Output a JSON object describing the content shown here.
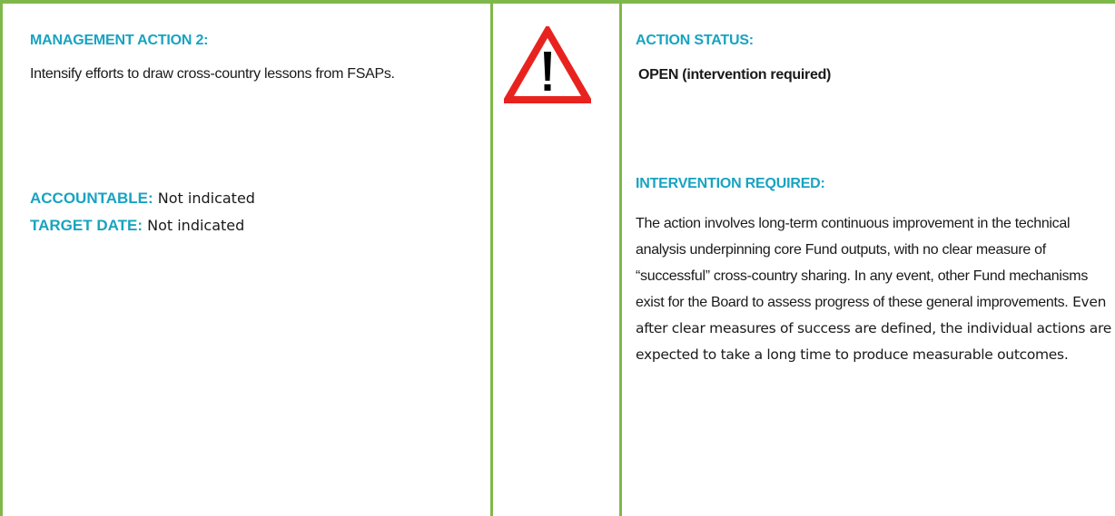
{
  "left": {
    "heading": "MANAGEMENT ACTION 2:",
    "action_text": "Intensify efforts to draw cross-country lessons from FSAPs.",
    "accountable_label": "ACCOUNTABLE:",
    "accountable_value": " Not indicated",
    "target_date_label": "TARGET DATE:",
    "target_date_value": " Not indicated"
  },
  "middle": {
    "icon": "warning-triangle-icon",
    "colors": {
      "triangle": "#e8231f",
      "fill": "#ffffff",
      "mark": "#000000"
    }
  },
  "right": {
    "status_heading": "ACTION STATUS:",
    "status_value": "OPEN (intervention required)",
    "intervention_heading": "INTERVENTION REQUIRED:",
    "intervention_text_part1": "The action involves long-term continuous improvement in the technical analysis underpinning core Fund outputs, with no clear measure of “successful” cross-country sharing. In any event, other Fund mechanisms exist for the Board to assess progress of these general improvements.",
    "intervention_text_part2": " Even after clear measures of success are defined, the individual actions are expected to take a long time to produce measurable outcomes."
  },
  "colors": {
    "border": "#7fb84a",
    "accent": "#18a3c1"
  }
}
